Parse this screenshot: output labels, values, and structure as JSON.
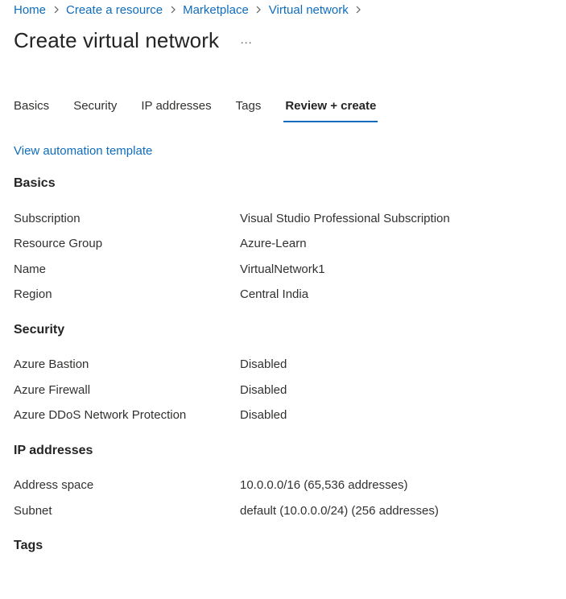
{
  "breadcrumb": {
    "items": [
      "Home",
      "Create a resource",
      "Marketplace",
      "Virtual network"
    ]
  },
  "header": {
    "title": "Create virtual network",
    "more_label": "···"
  },
  "tabs": [
    {
      "label": "Basics",
      "active": false
    },
    {
      "label": "Security",
      "active": false
    },
    {
      "label": "IP addresses",
      "active": false
    },
    {
      "label": "Tags",
      "active": false
    },
    {
      "label": "Review + create",
      "active": true
    }
  ],
  "automation_link": "View automation template",
  "sections": {
    "basics": {
      "heading": "Basics",
      "rows": [
        {
          "label": "Subscription",
          "value": "Visual Studio Professional Subscription"
        },
        {
          "label": "Resource Group",
          "value": "Azure-Learn"
        },
        {
          "label": "Name",
          "value": "VirtualNetwork1"
        },
        {
          "label": "Region",
          "value": "Central India"
        }
      ]
    },
    "security": {
      "heading": "Security",
      "rows": [
        {
          "label": "Azure Bastion",
          "value": "Disabled"
        },
        {
          "label": "Azure Firewall",
          "value": "Disabled"
        },
        {
          "label": "Azure DDoS Network Protection",
          "value": "Disabled"
        }
      ]
    },
    "ip_addresses": {
      "heading": "IP addresses",
      "rows": [
        {
          "label": "Address space",
          "value": "10.0.0.0/16 (65,536 addresses)"
        },
        {
          "label": "Subnet",
          "value": "default (10.0.0.0/24) (256 addresses)"
        }
      ]
    },
    "tags": {
      "heading": "Tags"
    }
  },
  "colors": {
    "link": "#0f6cbd",
    "text": "#323130",
    "heading": "#242424",
    "tab_underline": "#0f6cbd"
  },
  "icons": {
    "breadcrumb_separator": "chevron-right-icon"
  }
}
